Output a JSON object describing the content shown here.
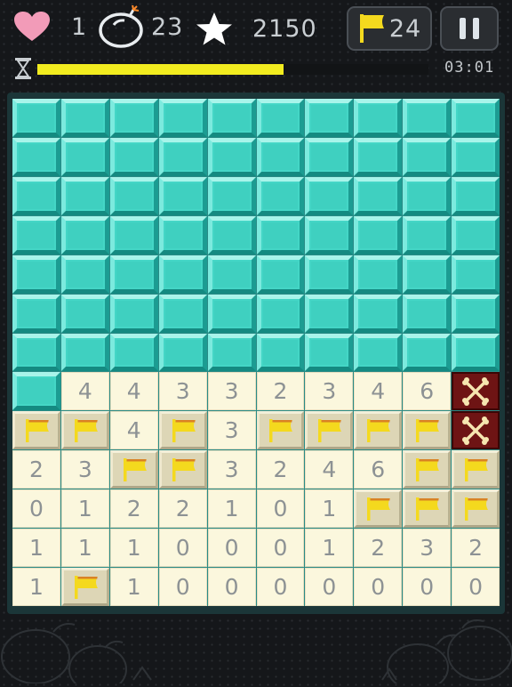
{
  "hud": {
    "lives": "1",
    "bombs": "23",
    "score": "2150",
    "flags": "24",
    "timer": "03:01",
    "timer_fraction": 0.63,
    "icons": {
      "lives": "heart-icon",
      "bombs": "bomb-icon",
      "score": "star-icon",
      "flags": "flag-icon",
      "pause": "pause-icon",
      "timer": "hourglass-icon"
    }
  },
  "colors": {
    "hidden_tile": "#44d6c6",
    "open_tile": "#fbf7dd",
    "flag": "#f4d91e",
    "mine_tile": "#6e1414",
    "timer_bar": "#f2ec1f",
    "heart": "#f29bb8"
  },
  "board": {
    "cols": 10,
    "rows": 13,
    "legend": {
      "H": "hidden",
      "F": "flag",
      "X": "mine",
      "0-9": "revealed number"
    },
    "grid": [
      [
        "H",
        "H",
        "H",
        "H",
        "H",
        "H",
        "H",
        "H",
        "H",
        "H"
      ],
      [
        "H",
        "H",
        "H",
        "H",
        "H",
        "H",
        "H",
        "H",
        "H",
        "H"
      ],
      [
        "H",
        "H",
        "H",
        "H",
        "H",
        "H",
        "H",
        "H",
        "H",
        "H"
      ],
      [
        "H",
        "H",
        "H",
        "H",
        "H",
        "H",
        "H",
        "H",
        "H",
        "H"
      ],
      [
        "H",
        "H",
        "H",
        "H",
        "H",
        "H",
        "H",
        "H",
        "H",
        "H"
      ],
      [
        "H",
        "H",
        "H",
        "H",
        "H",
        "H",
        "H",
        "H",
        "H",
        "H"
      ],
      [
        "H",
        "H",
        "H",
        "H",
        "H",
        "H",
        "H",
        "H",
        "H",
        "H"
      ],
      [
        "H",
        "4",
        "4",
        "3",
        "3",
        "2",
        "3",
        "4",
        "6",
        "X"
      ],
      [
        "F",
        "F",
        "4",
        "F",
        "3",
        "F",
        "F",
        "F",
        "F",
        "X"
      ],
      [
        "2",
        "3",
        "F",
        "F",
        "3",
        "2",
        "4",
        "6",
        "F",
        "F"
      ],
      [
        "0",
        "1",
        "2",
        "2",
        "1",
        "0",
        "1",
        "F",
        "F",
        "F"
      ],
      [
        "1",
        "1",
        "1",
        "0",
        "0",
        "0",
        "1",
        "2",
        "3",
        "2"
      ],
      [
        "1",
        "F",
        "1",
        "0",
        "0",
        "0",
        "0",
        "0",
        "0",
        "0"
      ]
    ]
  }
}
